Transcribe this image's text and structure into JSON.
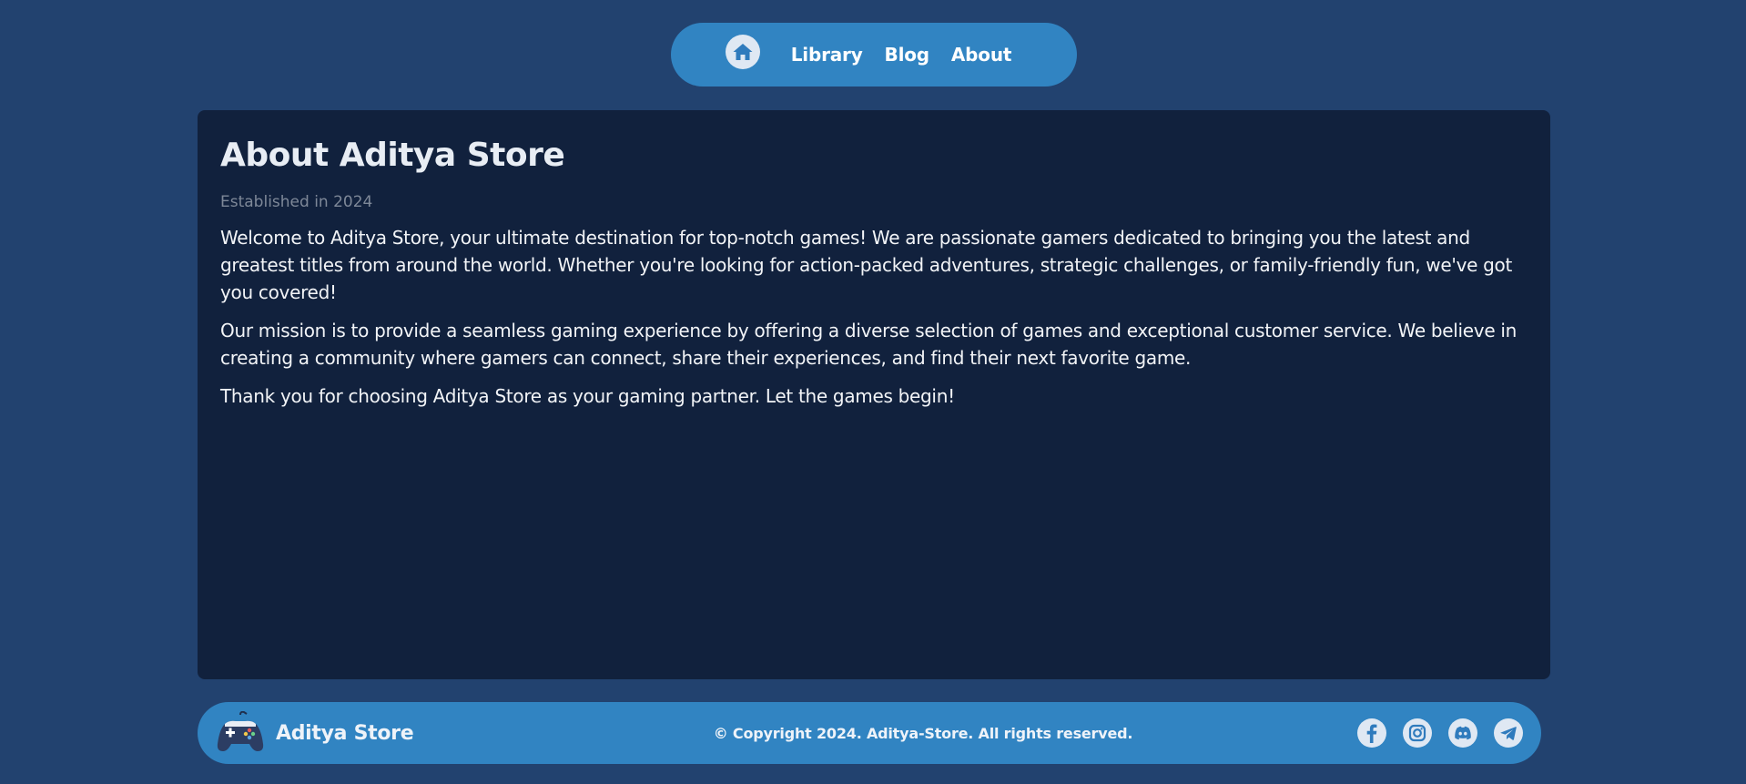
{
  "nav": {
    "home_icon": "home-icon",
    "links": [
      "Library",
      "Blog",
      "About"
    ]
  },
  "about": {
    "title": "About Aditya Store",
    "established": "Established in 2024",
    "paragraphs": [
      "Welcome to Aditya Store, your ultimate destination for top-notch games! We are passionate gamers dedicated to bringing you the latest and greatest titles from around the world. Whether you're looking for action-packed adventures, strategic challenges, or family-friendly fun, we've got you covered!",
      "Our mission is to provide a seamless gaming experience by offering a diverse selection of games and exceptional customer service. We believe in creating a community where gamers can connect, share their experiences, and find their next favorite game.",
      "Thank you for choosing Aditya Store as your gaming partner. Let the games begin!"
    ]
  },
  "footer": {
    "logo_icon": "gamepad-icon",
    "brand": "Aditya Store",
    "copyright": "© Copyright 2024. Aditya-Store. All rights reserved.",
    "socials": [
      "facebook-icon",
      "instagram-icon",
      "discord-icon",
      "telegram-icon"
    ]
  },
  "colors": {
    "page_background": "#22426f",
    "accent": "#3184c2",
    "card_background": "#11213d"
  }
}
